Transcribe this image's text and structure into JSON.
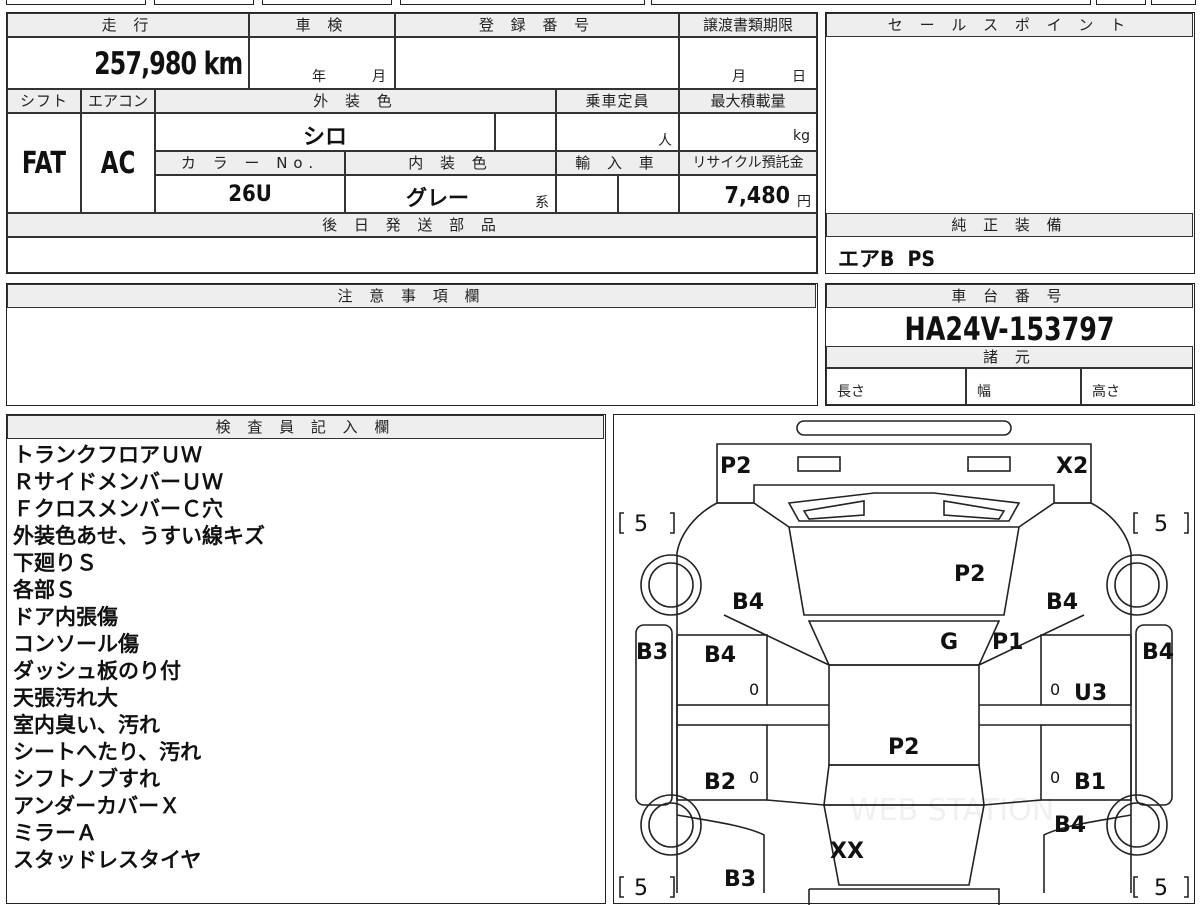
{
  "top_form": {
    "mileage": {
      "label": "走 行",
      "value": "257,980 km"
    },
    "shaken": {
      "label": "車 検",
      "year": "年",
      "month": "月"
    },
    "registration": {
      "label": "登 録 番 号",
      "value": ""
    },
    "transfer_deadline": {
      "label": "譲渡書類期限",
      "month": "月",
      "day": "日"
    },
    "shift": {
      "label": "シフト",
      "value": "FAT"
    },
    "aircon": {
      "label": "エアコン",
      "value": "AC"
    },
    "exterior_color": {
      "label": "外 装 色",
      "value": "シロ"
    },
    "capacity": {
      "label": "乗車定員",
      "unit": "人"
    },
    "max_load": {
      "label": "最大積載量",
      "unit": "kg"
    },
    "color_no": {
      "label": "カ ラ ー No.",
      "value": "26U"
    },
    "interior_color": {
      "label": "内 装 色",
      "value": "グレー",
      "suffix": "系"
    },
    "import": {
      "label": "輸 入 車"
    },
    "recycle": {
      "label": "リサイクル預託金",
      "value": "7,480",
      "unit": "円"
    },
    "later_parts": {
      "label": "後 日 発 送 部 品",
      "value": ""
    }
  },
  "sales_point": {
    "label": "セ ー ル ス ポ イ ン ト",
    "value": ""
  },
  "genuine_equipment": {
    "label": "純 正 装 備",
    "value": "エアB  PS"
  },
  "caution": {
    "label": "注 意 事 項 欄",
    "value": ""
  },
  "chassis": {
    "label": "車 台 番 号",
    "value": "HA24V-153797"
  },
  "specs": {
    "label": "諸 元",
    "length": "長さ",
    "width": "幅",
    "height": "高さ"
  },
  "inspector": {
    "label": "検 査 員 記 入 欄",
    "lines": [
      "トランクフロアＵＷ",
      "ＲサイドメンバーＵＷ",
      "ＦクロスメンバーＣ穴",
      "外装色あせ、うすい線キズ",
      "下廻りＳ",
      "各部Ｓ",
      "ドア内張傷",
      "コンソール傷",
      "ダッシュ板のり付",
      "天張汚れ大",
      "室内臭い、汚れ",
      "シートへたり、汚れ",
      "シフトノブすれ",
      "アンダーカバーＸ",
      "ミラーＡ",
      "スタッドレスタイヤ"
    ]
  },
  "diagram": {
    "marks": {
      "rear_left": "P2",
      "rear_right": "X2",
      "tire_tl": "5",
      "tire_tr": "5",
      "tire_bl": "5",
      "tire_br": "5",
      "rear_glass": "P2",
      "left_rear_quarter": "B4",
      "right_rear_quarter": "B4",
      "roof_glass": "G",
      "roof_p1": "P1",
      "left_side": "B3",
      "right_side": "B4",
      "left_rear_door": "B4",
      "right_rear_door": "U3",
      "roof": "P2",
      "left_front_door": "B2",
      "right_front_door": "B1",
      "right_fender": "B4",
      "hood": "XX",
      "front_left": "B3",
      "door_zero_1": "0",
      "door_zero_2": "0",
      "door_zero_3": "0",
      "door_zero_4": "0"
    },
    "watermark": "WEB STATION"
  }
}
